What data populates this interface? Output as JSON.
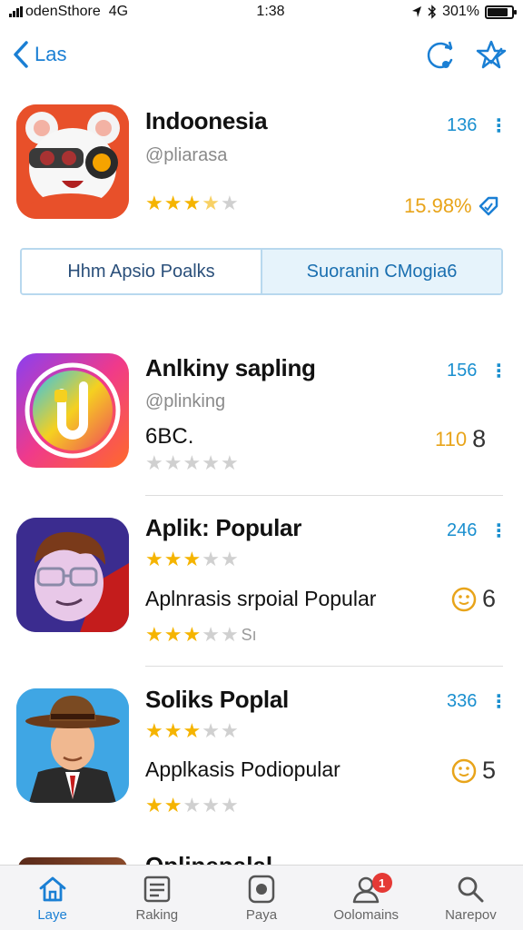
{
  "status": {
    "carrier": "odenSthore",
    "network": "4G",
    "time": "1:38",
    "battery": "301%",
    "battery_level": 0.85
  },
  "nav": {
    "back_label": "Las"
  },
  "featured": {
    "title": "Indoonesia",
    "subtitle": "@pliarasa",
    "count": "136",
    "rating": 3.5,
    "right_value": "15.98%"
  },
  "segment": {
    "left_label": "Hhm Apsio Poalks",
    "right_label": "Suoranin  CMogia6"
  },
  "apps": [
    {
      "title": "Anlkiny sapling",
      "subtitle": "@plinking",
      "detail": "6BC.",
      "count": "156",
      "rating": 0,
      "right_value": "110",
      "right_num": "8"
    },
    {
      "title": "Aplik: Popular",
      "desc": "Aplnrasis srpoial Popular",
      "count": "246",
      "rating": 3,
      "rating2": 3,
      "rating2_suffix": "Sı",
      "right_num": "6"
    },
    {
      "title": "Soliks Poplal",
      "desc": "Applkasis Podiopular",
      "count": "336",
      "rating": 3,
      "rating2": 2,
      "right_num": "5"
    }
  ],
  "peek_title": "Oplinenalal",
  "tabs": [
    {
      "label": "Laye",
      "icon": "home-icon",
      "active": true
    },
    {
      "label": "Raking",
      "icon": "list-icon",
      "active": false
    },
    {
      "label": "Paya",
      "icon": "pay-icon",
      "active": false
    },
    {
      "label": "Oolomains",
      "icon": "user-icon",
      "active": false,
      "badge": "1"
    },
    {
      "label": "Narepov",
      "icon": "search-icon",
      "active": false
    }
  ],
  "colors": {
    "accent": "#1a7fd4",
    "star": "#f5b400",
    "badge": "#e53935",
    "count": "#1a8fcf"
  }
}
